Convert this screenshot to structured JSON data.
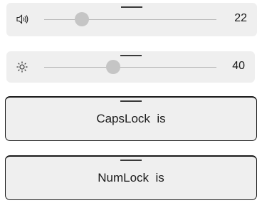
{
  "volume_osd": {
    "icon": "speaker-volume-icon",
    "value": "22",
    "level_percent": 22
  },
  "brightness_osd": {
    "icon": "sun-brightness-icon",
    "value": "40",
    "level_percent": 40
  },
  "capslock_osd": {
    "message": "CapsLock  is"
  },
  "numlock_osd": {
    "message": "NumLock  is"
  },
  "colors": {
    "panel": "#efefef",
    "knob": "#c5c5c5",
    "track": "#b9b9b9",
    "text": "#1a1a1a"
  }
}
